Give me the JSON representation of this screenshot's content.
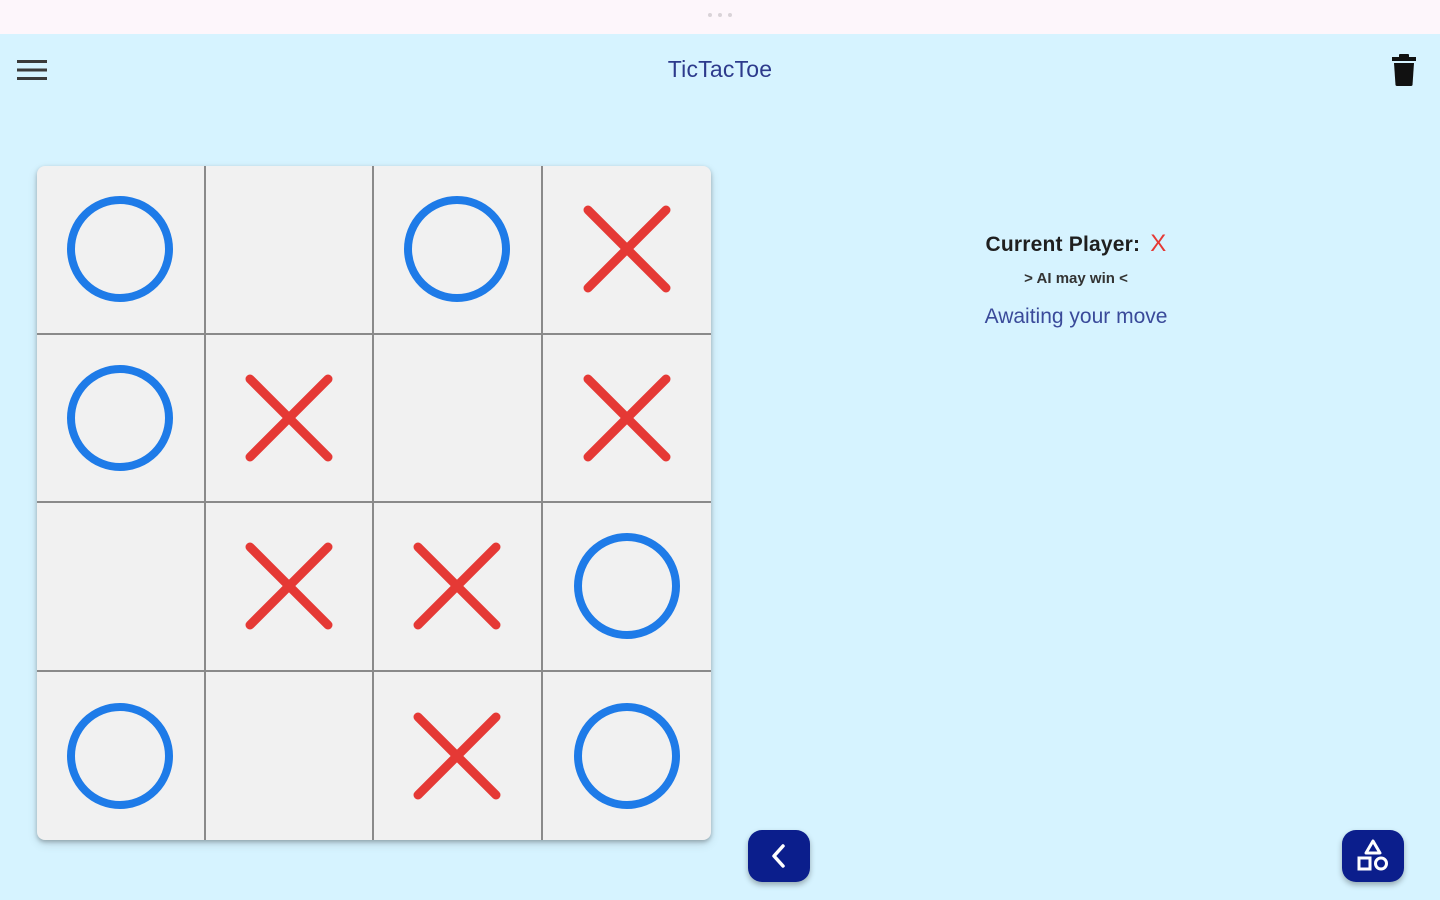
{
  "app": {
    "title": "TicTacToe"
  },
  "icons": {
    "menu": "menu-icon",
    "trash": "trash-icon",
    "back": "chevron-left-icon",
    "shapes": "shapes-icon"
  },
  "colors": {
    "background": "#d6f3ff",
    "x_mark": "#e53935",
    "o_mark": "#1e7be8",
    "fab": "#0b1e8c",
    "title": "#2d3a8c"
  },
  "board": {
    "size": 4,
    "cells": [
      [
        "O",
        "",
        "O",
        "X"
      ],
      [
        "O",
        "X",
        "",
        "X"
      ],
      [
        "",
        "X",
        "X",
        "O"
      ],
      [
        "O",
        "",
        "X",
        "O"
      ]
    ]
  },
  "info": {
    "current_player_label": "Current Player:",
    "current_player_mark": "X",
    "hint": "> AI may win <",
    "status": "Awaiting your move"
  }
}
